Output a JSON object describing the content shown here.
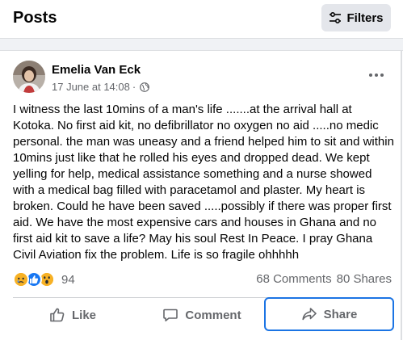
{
  "header": {
    "title": "Posts",
    "filters_label": "Filters"
  },
  "post": {
    "author": "Emelia Van Eck",
    "date": "17 June at 14:08",
    "separator": "·",
    "privacy_icon": "globe-icon",
    "text": "I witness the last 10mins of a man's life .......at the arrival hall at Kotoka. No first aid kit, no defibrillator no oxygen no aid .....no medic personal. the man was uneasy and a friend helped him to sit and within 10mins just like that he rolled his eyes and dropped dead. We kept yelling for help, medical assistance something and a nurse showed with a medical bag filled with paracetamol and plaster. My heart is broken. Could he have been saved .....possibly  if there was proper first aid. We have the most expensive cars and houses in Ghana and no first aid kit to save a life? May his soul Rest In Peace. I pray Ghana Civil Aviation fix the problem. Life is so fragile ohhhhh",
    "reactions": {
      "icons": [
        "sad-reaction-icon",
        "like-reaction-icon",
        "wow-reaction-icon"
      ],
      "count": "94"
    },
    "comments": "68 Comments",
    "shares": "80 Shares"
  },
  "actions": {
    "like": "Like",
    "comment": "Comment",
    "share": "Share"
  },
  "colors": {
    "accent": "#1b74e4",
    "reaction_yellow": "#f7b125",
    "reaction_blue": "#1877f2",
    "secondary_text": "#65676b"
  }
}
